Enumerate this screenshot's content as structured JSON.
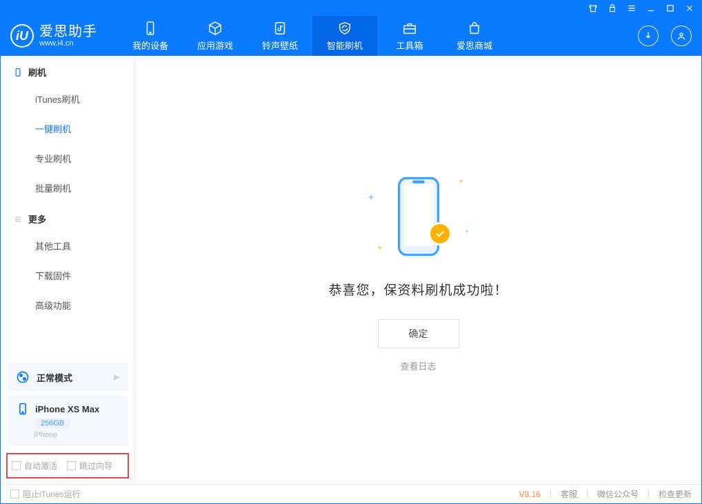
{
  "brand": {
    "name": "爱思助手",
    "url": "www.i4.cn",
    "badge": "iU"
  },
  "navTabs": [
    {
      "label": "我的设备"
    },
    {
      "label": "应用游戏"
    },
    {
      "label": "铃声壁纸"
    },
    {
      "label": "智能刷机"
    },
    {
      "label": "工具箱"
    },
    {
      "label": "爱思商城"
    }
  ],
  "sidebar": {
    "section1": {
      "title": "刷机",
      "items": [
        {
          "label": "iTunes刷机"
        },
        {
          "label": "一键刷机"
        },
        {
          "label": "专业刷机"
        },
        {
          "label": "批量刷机"
        }
      ]
    },
    "section2": {
      "title": "更多",
      "items": [
        {
          "label": "其他工具"
        },
        {
          "label": "下载固件"
        },
        {
          "label": "高级功能"
        }
      ]
    }
  },
  "modeCard": {
    "label": "正常模式"
  },
  "deviceCard": {
    "name": "iPhone XS Max",
    "storage": "256GB",
    "type": "iPhone"
  },
  "bottomOptions": {
    "opt1": "自动激活",
    "opt2": "跳过向导"
  },
  "main": {
    "title": "恭喜您，保资料刷机成功啦！",
    "okBtn": "确定",
    "logLink": "查看日志"
  },
  "statusbar": {
    "blockItunes": "阻止iTunes运行",
    "version": "V8.16",
    "links": [
      "客服",
      "微信公众号",
      "检查更新"
    ]
  },
  "colors": {
    "accent": "#0a7bff",
    "highlightBorder": "#e34a4a",
    "checkBadge": "#ffb300"
  }
}
